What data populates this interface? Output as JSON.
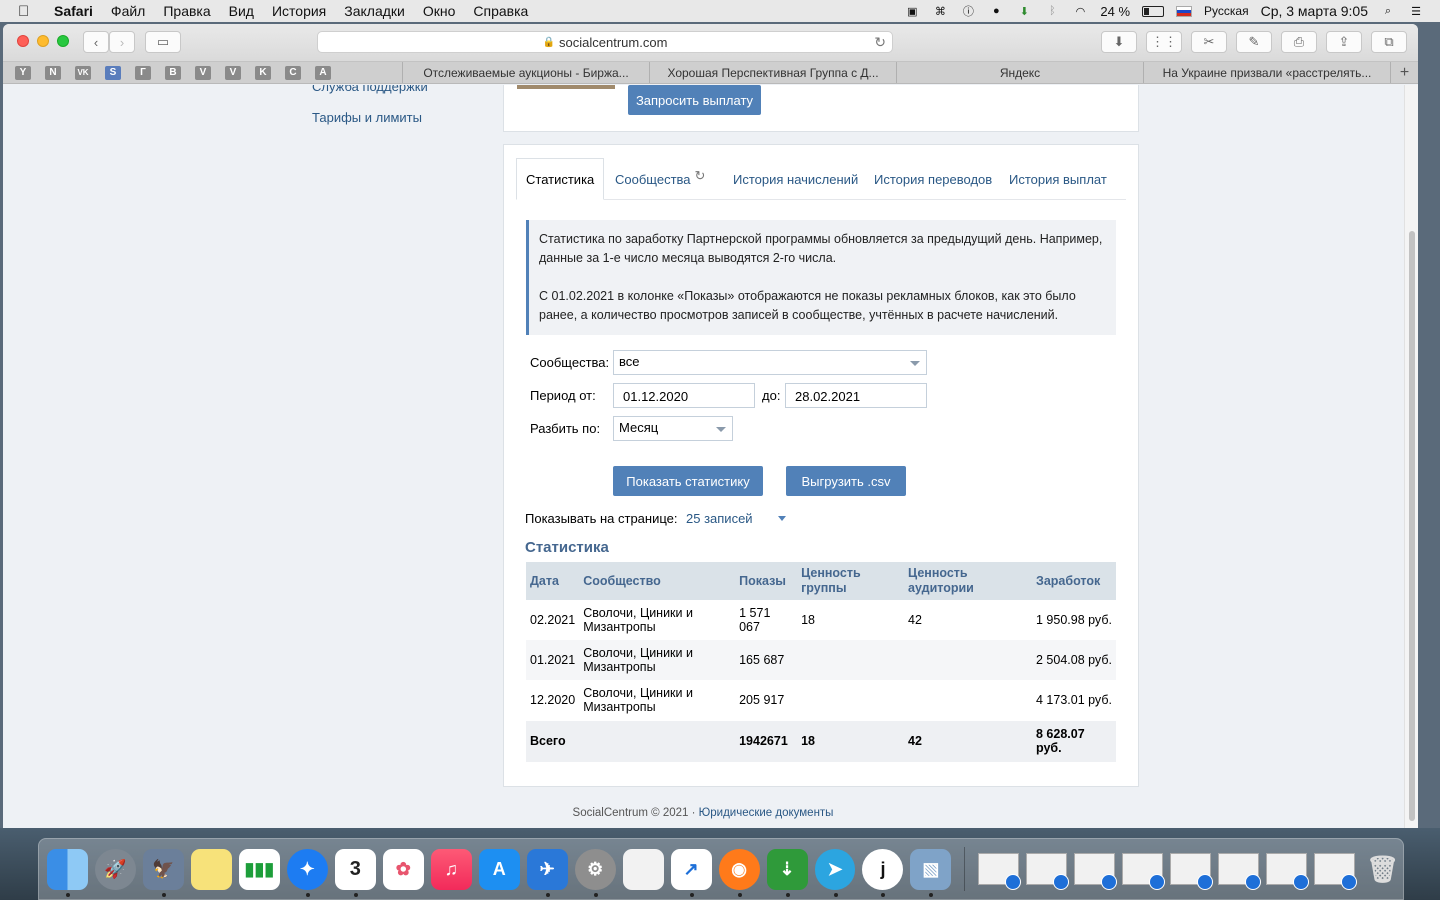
{
  "menubar": {
    "app": "Safari",
    "items": [
      "Файл",
      "Правка",
      "Вид",
      "История",
      "Закладки",
      "Окно",
      "Справка"
    ],
    "battery": "24 %",
    "input_source": "Русская",
    "datetime": "Ср, 3 марта  9:05"
  },
  "browser": {
    "url": "socialcentrum.com",
    "favorites": [
      "Y",
      "N",
      "VK",
      "S",
      "Г",
      "B",
      "V",
      "V",
      "K",
      "C",
      "A"
    ],
    "tabs": [
      "Отслеживаемые аукционы - Биржа...",
      "Хорошая Перспективная Группа с Д...",
      "Яндекс",
      "На Украине призвали «расстрелять..."
    ]
  },
  "sidebar": {
    "links": [
      "Служба поддержки",
      "Тарифы и лимиты"
    ]
  },
  "payout": {
    "button": "Запросить выплату"
  },
  "tabs": [
    {
      "label": "Статистика"
    },
    {
      "label": "Сообщества"
    },
    {
      "label": "История начислений"
    },
    {
      "label": "История переводов"
    },
    {
      "label": "История выплат"
    }
  ],
  "info": {
    "p1": "Статистика по заработку Партнерской программы обновляется за предыдущий день. Например, данные за 1-е число месяца выводятся 2-го числа.",
    "p2": "С 01.02.2021 в колонке «Показы» отображаются не показы рекламных блоков, как это было ранее, а количество просмотров записей в сообществе, учтённых в расчете начислений."
  },
  "filters": {
    "communities_label": "Сообщества:",
    "communities_value": "все",
    "period_from_label": "Период от:",
    "period_from": "01.12.2020",
    "period_to_label": "до:",
    "period_to": "28.02.2021",
    "split_label": "Разбить по:",
    "split_value": "Месяц"
  },
  "actions": {
    "show": "Показать статистику",
    "export": "Выгрузить .csv"
  },
  "per_page": {
    "label": "Показывать на странице:",
    "value": "25 записей"
  },
  "stats": {
    "title": "Статистика",
    "headers": [
      "Дата",
      "Сообщество",
      "Показы",
      "Ценность группы",
      "Ценность аудитории",
      "Заработок"
    ],
    "rows": [
      {
        "date": "02.2021",
        "community": "Сволочи, Циники и Мизантропы",
        "views": "1 571 067",
        "group_value": "18",
        "audience_value": "42",
        "earnings": "1 950.98 руб."
      },
      {
        "date": "01.2021",
        "community": "Сволочи, Циники и Мизантропы",
        "views": "165 687",
        "group_value": "",
        "audience_value": "",
        "earnings": "2 504.08 руб."
      },
      {
        "date": "12.2020",
        "community": "Сволочи, Циники и Мизантропы",
        "views": "205 917",
        "group_value": "",
        "audience_value": "",
        "earnings": "4 173.01 руб."
      }
    ],
    "total": {
      "label": "Всего",
      "views": "1942671",
      "group_value": "18",
      "audience_value": "42",
      "earnings": "8 628.07 руб."
    }
  },
  "footer": {
    "copyright": "SocialCentrum © 2021 · ",
    "legal_link": "Юридические документы"
  }
}
